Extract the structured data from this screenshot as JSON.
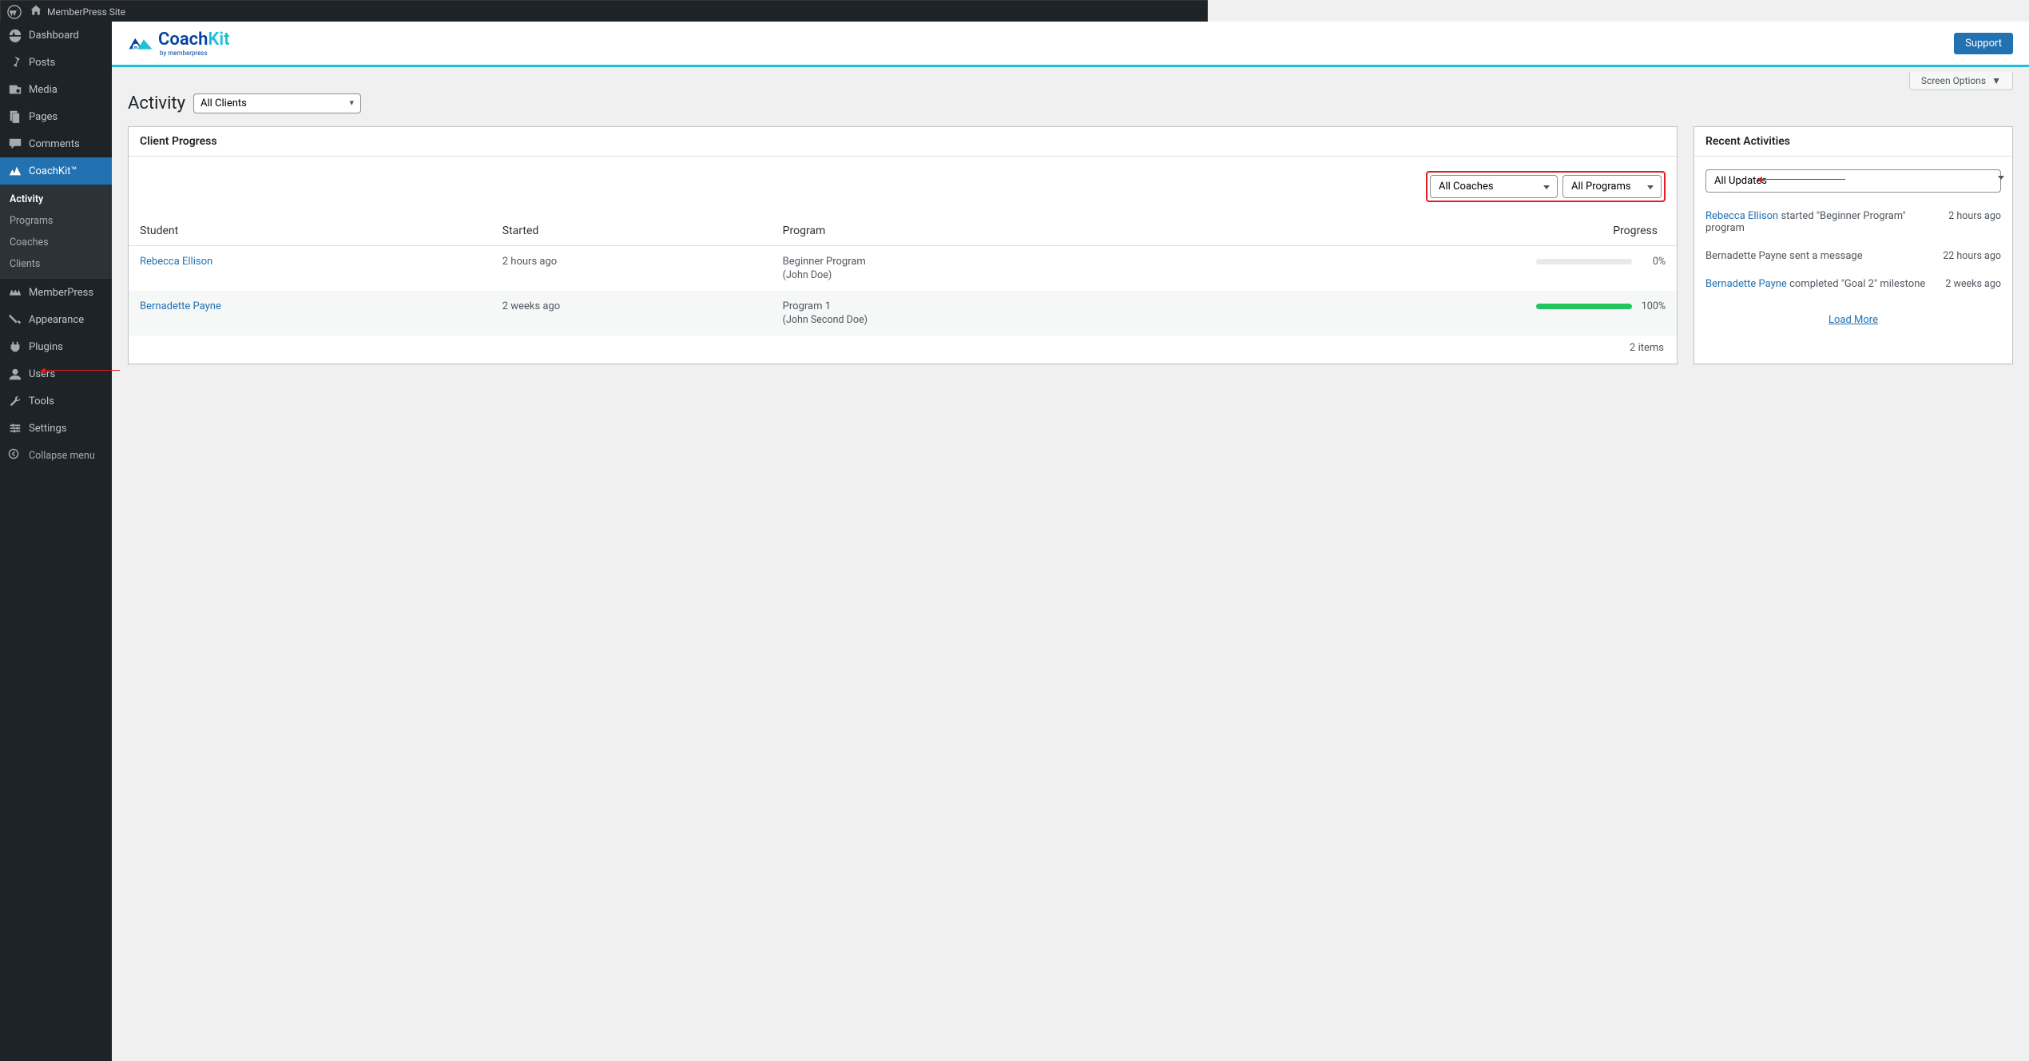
{
  "adminbar": {
    "site_name": "MemberPress Site"
  },
  "sidebar": {
    "items": [
      {
        "label": "Dashboard",
        "icon": "dashboard"
      },
      {
        "label": "Posts",
        "icon": "pin"
      },
      {
        "label": "Media",
        "icon": "media"
      },
      {
        "label": "Pages",
        "icon": "page"
      },
      {
        "label": "Comments",
        "icon": "comment"
      },
      {
        "label": "CoachKit™",
        "icon": "coachkit",
        "current": true
      },
      {
        "label": "MemberPress",
        "icon": "memberpress"
      },
      {
        "label": "Appearance",
        "icon": "appearance"
      },
      {
        "label": "Plugins",
        "icon": "plugin"
      },
      {
        "label": "Users",
        "icon": "user"
      },
      {
        "label": "Tools",
        "icon": "tools"
      },
      {
        "label": "Settings",
        "icon": "settings"
      }
    ],
    "submenu": [
      {
        "label": "Activity",
        "active": true
      },
      {
        "label": "Programs"
      },
      {
        "label": "Coaches"
      },
      {
        "label": "Clients"
      }
    ],
    "collapse": "Collapse menu"
  },
  "logo": {
    "name": "CoachKit",
    "sub": "by memberpress"
  },
  "support_label": "Support",
  "screen_options_label": "Screen Options",
  "page_title": "Activity",
  "clients_dropdown": "All Clients",
  "left_panel_title": "Client Progress",
  "filters": {
    "coaches": "All Coaches",
    "programs": "All Programs"
  },
  "table": {
    "headers": {
      "student": "Student",
      "started": "Started",
      "program": "Program",
      "progress": "Progress"
    },
    "rows": [
      {
        "student": "Rebecca Ellison",
        "started": "2 hours ago",
        "program": "Beginner Program",
        "coach": "(John Doe)",
        "pct": 0,
        "pct_label": "0%"
      },
      {
        "student": "Bernadette Payne",
        "started": "2 weeks ago",
        "program": "Program 1",
        "coach": "(John Second Doe)",
        "pct": 100,
        "pct_label": "100%"
      }
    ],
    "items_count": "2 items"
  },
  "right_panel_title": "Recent Activities",
  "updates_dropdown": "All Updates",
  "activities": [
    {
      "link": "Rebecca Ellison",
      "text": " started \"Beginner Program\" program",
      "time": "2 hours ago"
    },
    {
      "link": "",
      "text": "Bernadette Payne sent a message",
      "time": "22 hours ago"
    },
    {
      "link": "Bernadette Payne",
      "text": " completed \"Goal 2\" milestone",
      "time": "2 weeks ago"
    }
  ],
  "load_more": "Load More"
}
